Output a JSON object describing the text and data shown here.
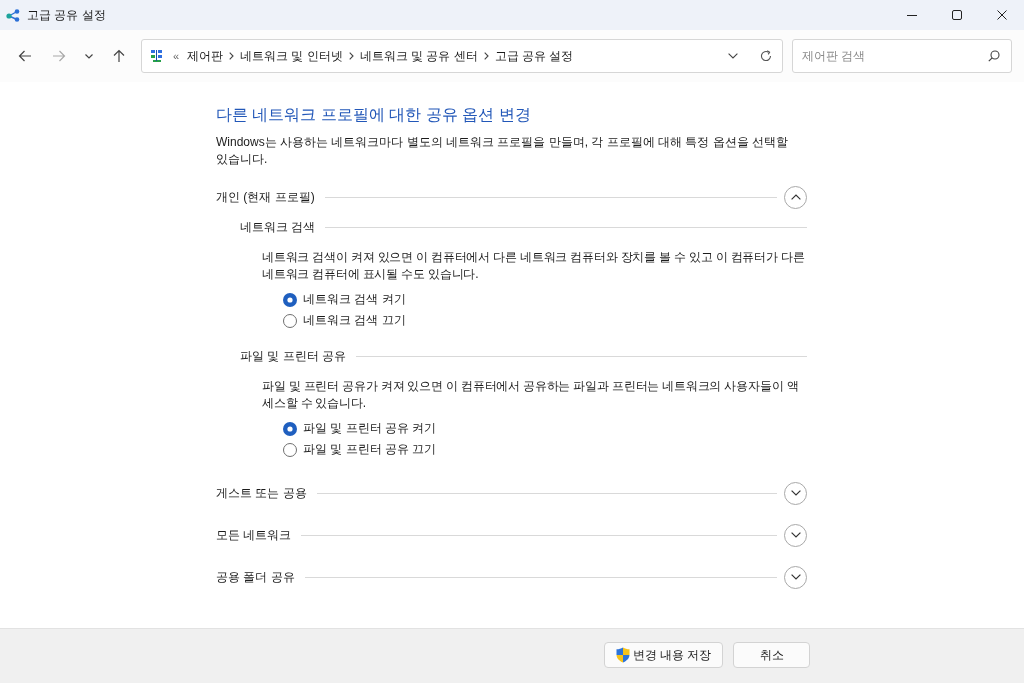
{
  "window": {
    "title": "고급 공유 설정"
  },
  "nav_buttons": [
    {
      "kind": "back",
      "disabled": false
    },
    {
      "kind": "forward",
      "disabled": true
    },
    {
      "kind": "recent",
      "disabled": false
    },
    {
      "kind": "up",
      "disabled": false
    }
  ],
  "address_bar": {
    "overflow": "«",
    "crumbs": [
      "제어판",
      "네트워크 및 인터넷",
      "네트워크 및 공유 센터",
      "고급 공유 설정"
    ]
  },
  "search": {
    "placeholder": "제어판 검색"
  },
  "heading": "다른 네트워크 프로필에 대한 공유 옵션 변경",
  "description": "Windows는 사용하는 네트워크마다 별도의 네트워크 프로필을 만들며, 각 프로필에 대해 특정 옵션을 선택할 있습니다.",
  "profiles": [
    {
      "title": "개인 (현재 프로필)",
      "expanded": true,
      "groups": [
        {
          "title": "네트워크 검색",
          "description": "네트워크 검색이 켜져 있으면 이 컴퓨터에서 다른 네트워크 컴퓨터와 장치를 볼 수 있고 이 컴퓨터가 다른 네트워크 컴퓨터에 표시될 수도 있습니다.",
          "options": [
            {
              "label": "네트워크 검색 켜기",
              "selected": true
            },
            {
              "label": "네트워크 검색 끄기",
              "selected": false
            }
          ]
        },
        {
          "title": "파일 및 프린터 공유",
          "description": "파일 및 프린터 공유가 켜져 있으면 이 컴퓨터에서 공유하는 파일과 프린터는 네트워크의 사용자들이 액세스할 수 있습니다.",
          "options": [
            {
              "label": "파일 및 프린터 공유 켜기",
              "selected": true
            },
            {
              "label": "파일 및 프린터 공유 끄기",
              "selected": false
            }
          ]
        }
      ]
    },
    {
      "title": "게스트 또는 공용",
      "expanded": false
    },
    {
      "title": "모든 네트워크",
      "expanded": false
    },
    {
      "title": "공용 폴더 공유",
      "expanded": false
    }
  ],
  "buttons": [
    {
      "label": "변경 내용 저장",
      "kind": "admin"
    },
    {
      "label": "취소",
      "kind": "plain"
    }
  ]
}
